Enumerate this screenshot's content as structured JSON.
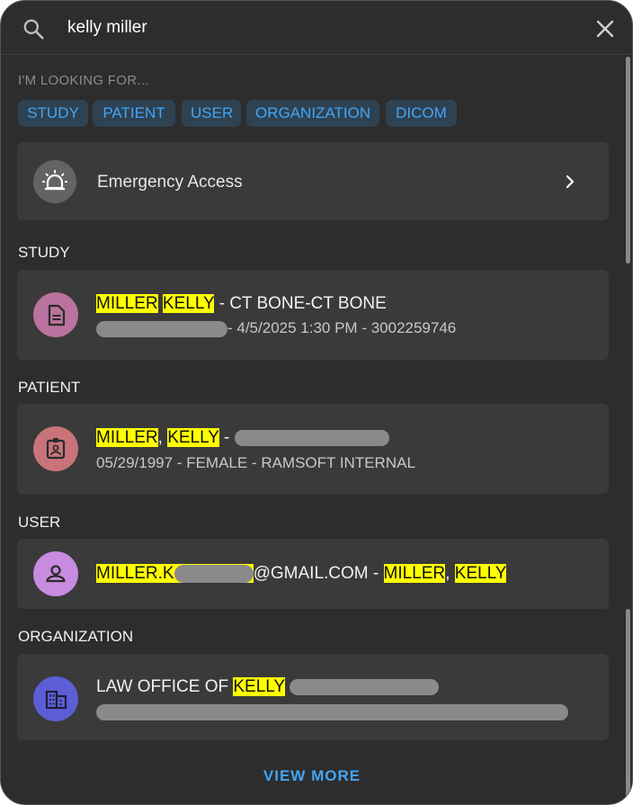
{
  "search": {
    "value": "kelly miller"
  },
  "looking_for": {
    "label": "I'M LOOKING FOR...",
    "chips": [
      "STUDY",
      "PATIENT",
      "USER",
      "ORGANIZATION",
      "DICOM"
    ]
  },
  "emergency": {
    "label": "Emergency Access"
  },
  "sections": {
    "study": "STUDY",
    "patient": "PATIENT",
    "user": "USER",
    "organization": "ORGANIZATION"
  },
  "study_result": {
    "name_last": "MILLER",
    "name_first": "KELLY",
    "description": " - CT BONE-CT BONE",
    "details": "- 4/5/2025 1:30 PM - 3002259746"
  },
  "patient_result": {
    "name_last": "MILLER",
    "comma": ",",
    "name_first": "KELLY",
    "dash": " -",
    "details": "05/29/1997 - FEMALE - RAMSOFT INTERNAL"
  },
  "user_result": {
    "email_prefix": "MILLER.K",
    "email_suffix": "@GMAIL.COM - ",
    "name_last": "MILLER",
    "comma": ",",
    "name_first": "KELLY"
  },
  "org_result": {
    "prefix": "LAW OFFICE OF ",
    "match": "KELLY"
  },
  "view_more": "VIEW MORE",
  "colors": {
    "accent": "#42a5f5",
    "highlight": "#ffff00",
    "study_avatar": "#b9739e",
    "patient_avatar": "#c9737a",
    "user_avatar": "#c78be0",
    "org_avatar": "#5c5ed6"
  }
}
